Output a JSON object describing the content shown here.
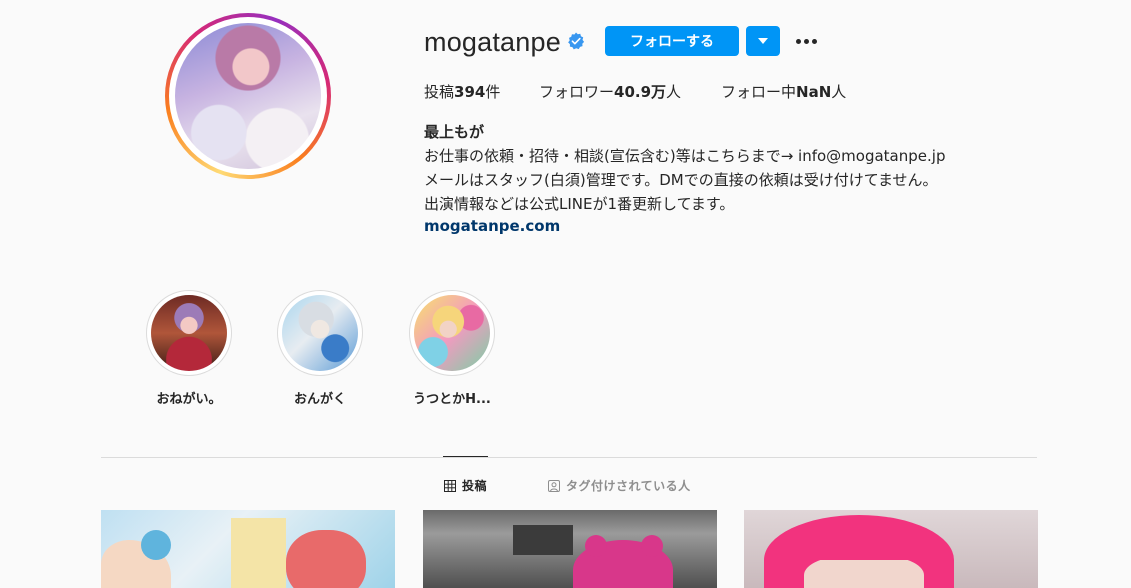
{
  "profile": {
    "username": "mogatanpe",
    "follow_label": "フォローする",
    "stats": {
      "posts_prefix": "投稿",
      "posts_count": "394",
      "posts_suffix": "件",
      "followers_prefix": "フォロワー",
      "followers_count": "40.9万",
      "followers_suffix": "人",
      "following_prefix": "フォロー中",
      "following_count": "NaN",
      "following_suffix": "人"
    },
    "full_name": "最上もが",
    "bio_lines": [
      "お仕事の依頼・招待・相談(宣伝含む)等はこちらまで→ info@mogatanpe.jp",
      "メールはスタッフ(白須)管理です。DMでの直接の依頼は受け付けてません。",
      "出演情報などは公式LINEが1番更新してます。"
    ],
    "website": "mogatanpe.com"
  },
  "highlights": [
    {
      "label": "おねがい。"
    },
    {
      "label": "おんがく"
    },
    {
      "label": "うつとかH..."
    }
  ],
  "tabs": [
    {
      "label": "投稿",
      "icon": "grid-icon",
      "active": true
    },
    {
      "label": "タグ付けされている人",
      "icon": "tagged-person-icon",
      "active": false
    }
  ],
  "colors": {
    "primary": "#0095f6",
    "link": "#00376b",
    "verified": "#3897f0"
  }
}
